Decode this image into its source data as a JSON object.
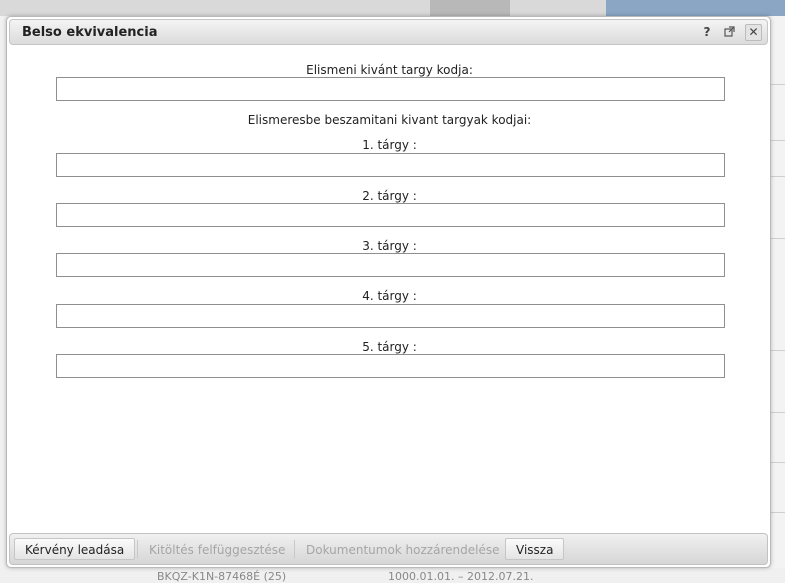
{
  "dialog": {
    "title": "Belso ekvivalencia",
    "help_icon": "?",
    "popout_icon": "popout-icon",
    "close_icon": "✕"
  },
  "form": {
    "target_label": "Elismeni kivánt targy kodja:",
    "target_value": "",
    "subjects_heading": "Elismeresbe beszamitani kivant targyak kodjai:",
    "subjects": [
      {
        "label": "1. tárgy :",
        "value": ""
      },
      {
        "label": "2. tárgy :",
        "value": ""
      },
      {
        "label": "3. tárgy :",
        "value": ""
      },
      {
        "label": "4. tárgy :",
        "value": ""
      },
      {
        "label": "5. tárgy :",
        "value": ""
      }
    ]
  },
  "footer": {
    "submit": "Kérvény leadása",
    "suspend": "Kitöltés felfüggesztése",
    "attach_docs": "Dokumentumok hozzárendelése",
    "back": "Vissza"
  },
  "background": {
    "row_code": "BKQZ-K1N-87468É (25)",
    "row_dates": "1000.01.01. – 2012.07.21."
  }
}
